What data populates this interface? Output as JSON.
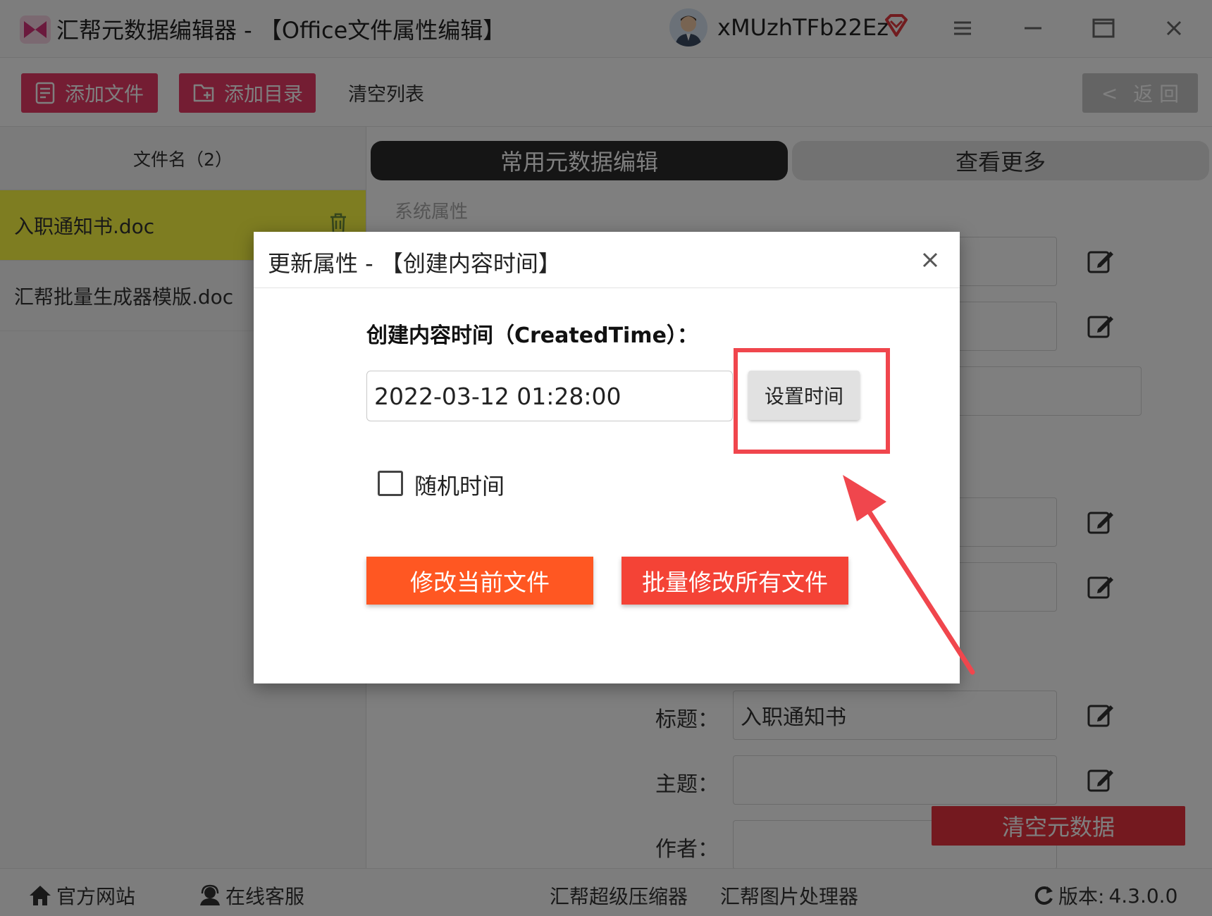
{
  "window": {
    "title": "汇帮元数据编辑器 - 【Office文件属性编辑】",
    "username": "xMUzhTFb22Ez",
    "icons": [
      "app-logo-icon",
      "user-avatar",
      "vip-diamond-icon",
      "menu-icon",
      "minimize-icon",
      "maximize-icon",
      "close-icon"
    ]
  },
  "toolbar": {
    "add_file": "添加文件",
    "add_folder": "添加目录",
    "clear_list": "清空列表",
    "back": "返 回",
    "back_arrow": "<"
  },
  "file_list": {
    "header": "文件名（2）",
    "files": [
      {
        "name": "入职通知书.doc",
        "selected": true
      },
      {
        "name": "汇帮批量生成器模版.doc",
        "selected": false
      }
    ]
  },
  "main": {
    "tabs": [
      {
        "label": "常用元数据编辑",
        "active": true
      },
      {
        "label": "查看更多",
        "active": false
      }
    ],
    "section": "系统属性",
    "fields": [
      {
        "label": "标题：",
        "value": "入职通知书"
      },
      {
        "label": "主题：",
        "value": ""
      },
      {
        "label": "作者：",
        "value": ""
      }
    ],
    "clear_metadata": "清空元数据"
  },
  "dialog": {
    "title": "更新属性 - 【创建内容时间】",
    "field_label": "创建内容时间（CreatedTime）：",
    "value": "2022-03-12 01:28:00",
    "set_time": "设置时间",
    "random_label": "随机时间",
    "random_checked": false,
    "apply_current": "修改当前文件",
    "apply_all": "批量修改所有文件"
  },
  "statusbar": {
    "website": "官方网站",
    "support": "在线客服",
    "compressor": "汇帮超级压缩器",
    "image_tool": "汇帮图片处理器",
    "version_label": "版本:",
    "version": "4.3.0.0"
  },
  "colors": {
    "accent_pink": "#e93a67",
    "selected_row": "#fdfb42",
    "btn_orange": "#ff5722",
    "btn_red": "#f44336",
    "annotation_red": "#f0464d"
  }
}
